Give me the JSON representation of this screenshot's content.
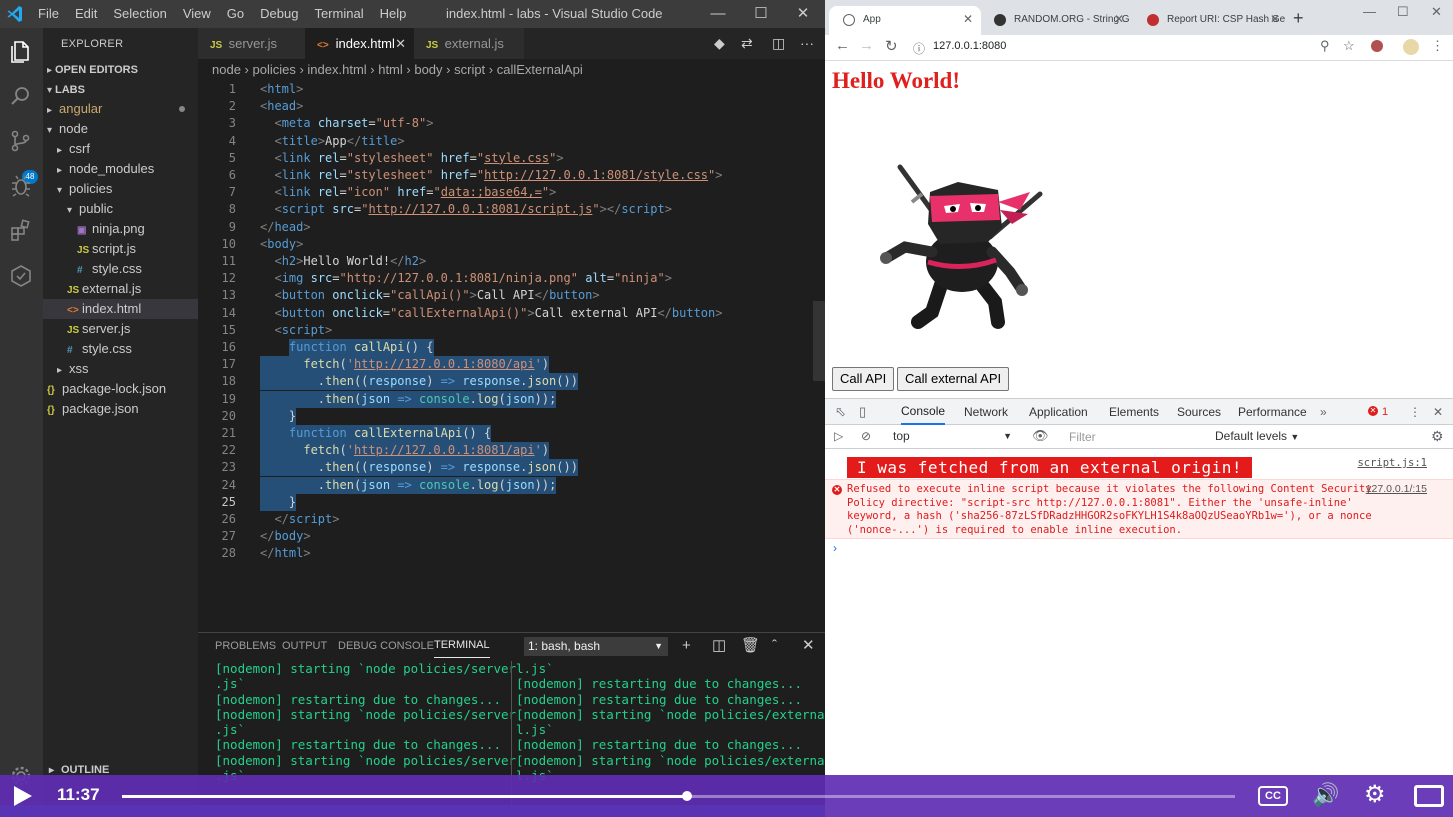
{
  "vscode": {
    "menu": [
      "File",
      "Edit",
      "Selection",
      "View",
      "Go",
      "Debug",
      "Terminal",
      "Help"
    ],
    "window_title": "index.html - labs - Visual Studio Code",
    "scm_badge": "48",
    "explorer_label": "EXPLORER",
    "open_editors_label": "OPEN EDITORS",
    "labs_label": "LABS",
    "tree": [
      {
        "label": "angular",
        "type": "folder",
        "open": false,
        "indent": 1,
        "modified": true
      },
      {
        "label": "node",
        "type": "folder",
        "open": true,
        "indent": 1
      },
      {
        "label": "csrf",
        "type": "folder",
        "open": false,
        "indent": 2
      },
      {
        "label": "node_modules",
        "type": "folder",
        "open": false,
        "indent": 2
      },
      {
        "label": "policies",
        "type": "folder",
        "open": true,
        "indent": 2
      },
      {
        "label": "public",
        "type": "folder",
        "open": true,
        "indent": 3
      },
      {
        "label": "ninja.png",
        "type": "img",
        "indent": 4
      },
      {
        "label": "script.js",
        "type": "js",
        "indent": 4
      },
      {
        "label": "style.css",
        "type": "css",
        "indent": 4
      },
      {
        "label": "external.js",
        "type": "js",
        "indent": 3
      },
      {
        "label": "index.html",
        "type": "html",
        "indent": 3,
        "selected": true
      },
      {
        "label": "server.js",
        "type": "js",
        "indent": 3
      },
      {
        "label": "style.css",
        "type": "css",
        "indent": 3
      },
      {
        "label": "xss",
        "type": "folder",
        "open": false,
        "indent": 2
      },
      {
        "label": "package-lock.json",
        "type": "json",
        "indent": 1
      },
      {
        "label": "package.json",
        "type": "json",
        "indent": 1
      }
    ],
    "outline_label": "OUTLINE",
    "tabs": [
      {
        "label": "server.js",
        "type": "js",
        "active": false
      },
      {
        "label": "index.html",
        "type": "html",
        "active": true
      },
      {
        "label": "external.js",
        "type": "js",
        "active": false
      }
    ],
    "breadcrumb": [
      "node",
      "policies",
      "index.html",
      "html",
      "body",
      "script",
      "callExternalApi"
    ],
    "code_lines": [
      [
        [
          "tk-punc",
          "<"
        ],
        [
          "tk-tag",
          "html"
        ],
        [
          "tk-punc",
          ">"
        ]
      ],
      [
        [
          "tk-punc",
          "<"
        ],
        [
          "tk-tag",
          "head"
        ],
        [
          "tk-punc",
          ">"
        ]
      ],
      [
        [
          "tk-text",
          "  "
        ],
        [
          "tk-punc",
          "<"
        ],
        [
          "tk-tag",
          "meta"
        ],
        [
          "tk-text",
          " "
        ],
        [
          "tk-attr",
          "charset"
        ],
        [
          "tk-text",
          "="
        ],
        [
          "tk-str",
          "\"utf-8\""
        ],
        [
          "tk-punc",
          ">"
        ]
      ],
      [
        [
          "tk-text",
          "  "
        ],
        [
          "tk-punc",
          "<"
        ],
        [
          "tk-tag",
          "title"
        ],
        [
          "tk-punc",
          ">"
        ],
        [
          "tk-text",
          "App"
        ],
        [
          "tk-punc",
          "</"
        ],
        [
          "tk-tag",
          "title"
        ],
        [
          "tk-punc",
          ">"
        ]
      ],
      [
        [
          "tk-text",
          "  "
        ],
        [
          "tk-punc",
          "<"
        ],
        [
          "tk-tag",
          "link"
        ],
        [
          "tk-text",
          " "
        ],
        [
          "tk-attr",
          "rel"
        ],
        [
          "tk-text",
          "="
        ],
        [
          "tk-str",
          "\"stylesheet\""
        ],
        [
          "tk-text",
          " "
        ],
        [
          "tk-attr",
          "href"
        ],
        [
          "tk-text",
          "="
        ],
        [
          "tk-str",
          "\""
        ],
        [
          "tk-url",
          "style.css"
        ],
        [
          "tk-str",
          "\""
        ],
        [
          "tk-punc",
          ">"
        ]
      ],
      [
        [
          "tk-text",
          "  "
        ],
        [
          "tk-punc",
          "<"
        ],
        [
          "tk-tag",
          "link"
        ],
        [
          "tk-text",
          " "
        ],
        [
          "tk-attr",
          "rel"
        ],
        [
          "tk-text",
          "="
        ],
        [
          "tk-str",
          "\"stylesheet\""
        ],
        [
          "tk-text",
          " "
        ],
        [
          "tk-attr",
          "href"
        ],
        [
          "tk-text",
          "="
        ],
        [
          "tk-str",
          "\""
        ],
        [
          "tk-url",
          "http://127.0.0.1:8081/style.css"
        ],
        [
          "tk-str",
          "\""
        ],
        [
          "tk-punc",
          ">"
        ]
      ],
      [
        [
          "tk-text",
          "  "
        ],
        [
          "tk-punc",
          "<"
        ],
        [
          "tk-tag",
          "link"
        ],
        [
          "tk-text",
          " "
        ],
        [
          "tk-attr",
          "rel"
        ],
        [
          "tk-text",
          "="
        ],
        [
          "tk-str",
          "\"icon\""
        ],
        [
          "tk-text",
          " "
        ],
        [
          "tk-attr",
          "href"
        ],
        [
          "tk-text",
          "="
        ],
        [
          "tk-str",
          "\""
        ],
        [
          "tk-url",
          "data:;base64,="
        ],
        [
          "tk-str",
          "\""
        ],
        [
          "tk-punc",
          ">"
        ]
      ],
      [
        [
          "tk-text",
          "  "
        ],
        [
          "tk-punc",
          "<"
        ],
        [
          "tk-tag",
          "script"
        ],
        [
          "tk-text",
          " "
        ],
        [
          "tk-attr",
          "src"
        ],
        [
          "tk-text",
          "="
        ],
        [
          "tk-str",
          "\""
        ],
        [
          "tk-url",
          "http://127.0.0.1:8081/script.js"
        ],
        [
          "tk-str",
          "\""
        ],
        [
          "tk-punc",
          "></"
        ],
        [
          "tk-tag",
          "script"
        ],
        [
          "tk-punc",
          ">"
        ]
      ],
      [
        [
          "tk-punc",
          "</"
        ],
        [
          "tk-tag",
          "head"
        ],
        [
          "tk-punc",
          ">"
        ]
      ],
      [
        [
          "tk-punc",
          "<"
        ],
        [
          "tk-tag",
          "body"
        ],
        [
          "tk-punc",
          ">"
        ]
      ],
      [
        [
          "tk-text",
          "  "
        ],
        [
          "tk-punc",
          "<"
        ],
        [
          "tk-tag",
          "h2"
        ],
        [
          "tk-punc",
          ">"
        ],
        [
          "tk-text",
          "Hello World!"
        ],
        [
          "tk-punc",
          "</"
        ],
        [
          "tk-tag",
          "h2"
        ],
        [
          "tk-punc",
          ">"
        ]
      ],
      [
        [
          "tk-text",
          "  "
        ],
        [
          "tk-punc",
          "<"
        ],
        [
          "tk-tag",
          "img"
        ],
        [
          "tk-text",
          " "
        ],
        [
          "tk-attr",
          "src"
        ],
        [
          "tk-text",
          "="
        ],
        [
          "tk-str",
          "\"http://127.0.0.1:8081/ninja.png\""
        ],
        [
          "tk-text",
          " "
        ],
        [
          "tk-attr",
          "alt"
        ],
        [
          "tk-text",
          "="
        ],
        [
          "tk-str",
          "\"ninja\""
        ],
        [
          "tk-punc",
          ">"
        ]
      ],
      [
        [
          "tk-text",
          "  "
        ],
        [
          "tk-punc",
          "<"
        ],
        [
          "tk-tag",
          "button"
        ],
        [
          "tk-text",
          " "
        ],
        [
          "tk-attr",
          "onclick"
        ],
        [
          "tk-text",
          "="
        ],
        [
          "tk-str",
          "\"callApi()\""
        ],
        [
          "tk-punc",
          ">"
        ],
        [
          "tk-text",
          "Call API"
        ],
        [
          "tk-punc",
          "</"
        ],
        [
          "tk-tag",
          "button"
        ],
        [
          "tk-punc",
          ">"
        ]
      ],
      [
        [
          "tk-text",
          "  "
        ],
        [
          "tk-punc",
          "<"
        ],
        [
          "tk-tag",
          "button"
        ],
        [
          "tk-text",
          " "
        ],
        [
          "tk-attr",
          "onclick"
        ],
        [
          "tk-text",
          "="
        ],
        [
          "tk-str",
          "\"callExternalApi()\""
        ],
        [
          "tk-punc",
          ">"
        ],
        [
          "tk-text",
          "Call external API"
        ],
        [
          "tk-punc",
          "</"
        ],
        [
          "tk-tag",
          "button"
        ],
        [
          "tk-punc",
          ">"
        ]
      ],
      [
        [
          "tk-text",
          "  "
        ],
        [
          "tk-punc",
          "<"
        ],
        [
          "tk-tag",
          "script"
        ],
        [
          "tk-punc",
          ">"
        ]
      ],
      [
        [
          "tk-text",
          "    "
        ],
        [
          "tk-kw",
          "function"
        ],
        [
          "tk-text",
          " "
        ],
        [
          "tk-fn",
          "callApi"
        ],
        [
          "tk-text",
          "() {"
        ]
      ],
      [
        [
          "tk-text",
          "      "
        ],
        [
          "tk-fn",
          "fetch"
        ],
        [
          "tk-text",
          "("
        ],
        [
          "tk-str",
          "'"
        ],
        [
          "tk-url",
          "http://127.0.0.1:8080/api"
        ],
        [
          "tk-str",
          "'"
        ],
        [
          "tk-text",
          ")"
        ]
      ],
      [
        [
          "tk-text",
          "        ."
        ],
        [
          "tk-fn",
          "then"
        ],
        [
          "tk-text",
          "(("
        ],
        [
          "tk-var",
          "response"
        ],
        [
          "tk-text",
          ") "
        ],
        [
          "tk-kw",
          "=>"
        ],
        [
          "tk-text",
          " "
        ],
        [
          "tk-var",
          "response"
        ],
        [
          "tk-text",
          "."
        ],
        [
          "tk-fn",
          "json"
        ],
        [
          "tk-text",
          "())"
        ]
      ],
      [
        [
          "tk-text",
          "        ."
        ],
        [
          "tk-fn",
          "then"
        ],
        [
          "tk-text",
          "("
        ],
        [
          "tk-var",
          "json"
        ],
        [
          "tk-text",
          " "
        ],
        [
          "tk-kw",
          "=>"
        ],
        [
          "tk-text",
          " "
        ],
        [
          "tk-cls",
          "console"
        ],
        [
          "tk-text",
          "."
        ],
        [
          "tk-fn",
          "log"
        ],
        [
          "tk-text",
          "("
        ],
        [
          "tk-var",
          "json"
        ],
        [
          "tk-text",
          "));"
        ]
      ],
      [
        [
          "tk-text",
          "    }"
        ]
      ],
      [
        [
          "tk-text",
          "    "
        ],
        [
          "tk-kw",
          "function"
        ],
        [
          "tk-text",
          " "
        ],
        [
          "tk-fn",
          "callExternalApi"
        ],
        [
          "tk-text",
          "() {"
        ]
      ],
      [
        [
          "tk-text",
          "      "
        ],
        [
          "tk-fn",
          "fetch"
        ],
        [
          "tk-text",
          "("
        ],
        [
          "tk-str",
          "'"
        ],
        [
          "tk-url",
          "http://127.0.0.1:8081/api"
        ],
        [
          "tk-str",
          "'"
        ],
        [
          "tk-text",
          ")"
        ]
      ],
      [
        [
          "tk-text",
          "        ."
        ],
        [
          "tk-fn",
          "then"
        ],
        [
          "tk-text",
          "(("
        ],
        [
          "tk-var",
          "response"
        ],
        [
          "tk-text",
          ") "
        ],
        [
          "tk-kw",
          "=>"
        ],
        [
          "tk-text",
          " "
        ],
        [
          "tk-var",
          "response"
        ],
        [
          "tk-text",
          "."
        ],
        [
          "tk-fn",
          "json"
        ],
        [
          "tk-text",
          "())"
        ]
      ],
      [
        [
          "tk-text",
          "        ."
        ],
        [
          "tk-fn",
          "then"
        ],
        [
          "tk-text",
          "("
        ],
        [
          "tk-var",
          "json"
        ],
        [
          "tk-text",
          " "
        ],
        [
          "tk-kw",
          "=>"
        ],
        [
          "tk-text",
          " "
        ],
        [
          "tk-cls",
          "console"
        ],
        [
          "tk-text",
          "."
        ],
        [
          "tk-fn",
          "log"
        ],
        [
          "tk-text",
          "("
        ],
        [
          "tk-var",
          "json"
        ],
        [
          "tk-text",
          "));"
        ]
      ],
      [
        [
          "tk-text",
          "    }"
        ]
      ],
      [
        [
          "tk-text",
          "  "
        ],
        [
          "tk-punc",
          "</"
        ],
        [
          "tk-tag",
          "script"
        ],
        [
          "tk-punc",
          ">"
        ]
      ],
      [
        [
          "tk-punc",
          "</"
        ],
        [
          "tk-tag",
          "body"
        ],
        [
          "tk-punc",
          ">"
        ]
      ],
      [
        [
          "tk-punc",
          "</"
        ],
        [
          "tk-tag",
          "html"
        ],
        [
          "tk-punc",
          ">"
        ]
      ]
    ],
    "current_line": 25,
    "panel_tabs": [
      "PROBLEMS",
      "OUTPUT",
      "DEBUG CONSOLE",
      "TERMINAL"
    ],
    "active_panel_tab": "TERMINAL",
    "terminal_select": "1: bash, bash",
    "terminal_left": "[nodemon] starting `node policies/server\n.js`\n[nodemon] restarting due to changes...\n[nodemon] starting `node policies/server\n.js`\n[nodemon] restarting due to changes...\n[nodemon] starting `node policies/server\n.js`",
    "terminal_right": "l.js`\n[nodemon] restarting due to changes...\n[nodemon] restarting due to changes...\n[nodemon] starting `node policies/externa\nl.js`\n[nodemon] restarting due to changes...\n[nodemon] starting `node policies/externa\nl.js`"
  },
  "chrome": {
    "tabs": [
      {
        "label": "App",
        "active": true
      },
      {
        "label": "RANDOM.ORG - String G",
        "active": false
      },
      {
        "label": "Report URI: CSP Hash Ge",
        "active": false
      }
    ],
    "url": "127.0.0.1:8080",
    "page": {
      "heading": "Hello World!",
      "btn_call_api": "Call API",
      "btn_call_external": "Call external API"
    },
    "devtools": {
      "tabs": [
        "Console",
        "Network",
        "Application",
        "Elements",
        "Sources",
        "Performance"
      ],
      "active_tab": "Console",
      "error_count": "1",
      "context": "top",
      "filter_placeholder": "Filter",
      "levels": "Default levels",
      "log_message": "I was fetched from an external origin!",
      "log_source": "script.js:1",
      "error_source": "127.0.0.1/:15",
      "error_text": "Refused to execute inline script because it violates the following Content Security Policy directive: \"script-src http://127.0.0.1:8081\". Either the 'unsafe-inline' keyword, a hash ('sha256-87zLSfDRadzHHGOR2soFKYLH1S4k8aOQzUSeaoYRb1w='), or a nonce ('nonce-...') is required to enable inline execution."
    }
  },
  "player": {
    "time": "11:37",
    "progress": 0.508
  }
}
